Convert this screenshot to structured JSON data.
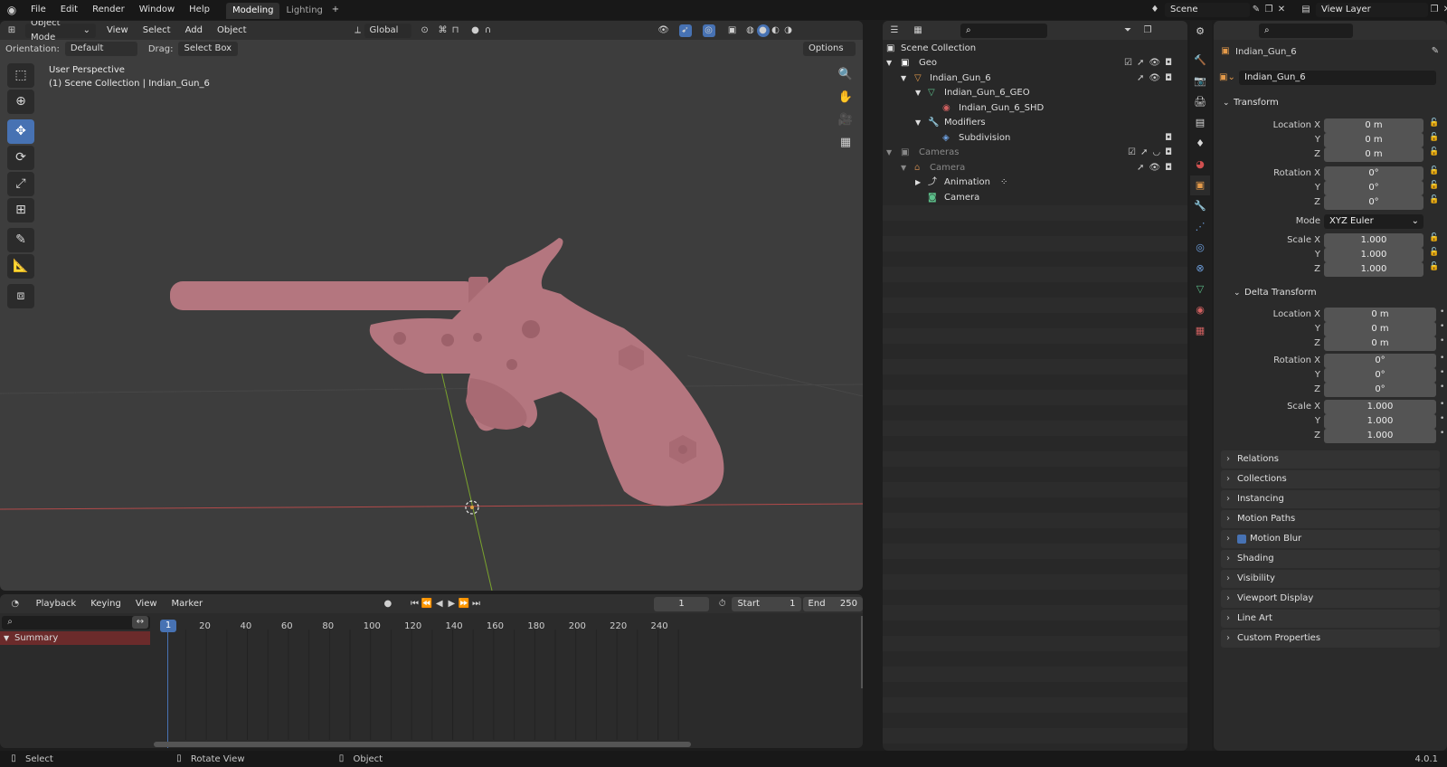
{
  "topbar": {
    "menus": [
      "File",
      "Edit",
      "Render",
      "Window",
      "Help"
    ],
    "workspaces": [
      "Modeling",
      "Lighting"
    ],
    "active_workspace": "Modeling",
    "scene": "Scene",
    "view_layer": "View Layer"
  },
  "viewport_header": {
    "mode": "Object Mode",
    "menus": [
      "View",
      "Select",
      "Add",
      "Object"
    ],
    "transform_orientation": "Global",
    "orientation_label": "Orientation:",
    "orientation_value": "Default",
    "drag_label": "Drag:",
    "drag_value": "Select Box",
    "options_label": "Options"
  },
  "viewport": {
    "perspective": "User Perspective",
    "context": "(1) Scene Collection | Indian_Gun_6",
    "tools": [
      "select-box",
      "cursor",
      "move",
      "rotate",
      "scale",
      "transform",
      "annotate",
      "measure",
      "add-cube"
    ]
  },
  "timeline": {
    "menus": [
      "Playback",
      "Keying",
      "View",
      "Marker"
    ],
    "current_frame": "1",
    "start_label": "Start",
    "start_value": "1",
    "end_label": "End",
    "end_value": "250",
    "ticks": [
      "1",
      "20",
      "40",
      "60",
      "80",
      "100",
      "120",
      "140",
      "160",
      "180",
      "200",
      "220",
      "240"
    ],
    "summary_label": "Summary"
  },
  "outliner": {
    "root": "Scene Collection",
    "rows": [
      {
        "label": "Geo",
        "icon": "collection-icon"
      },
      {
        "label": "Indian_Gun_6",
        "icon": "object-icon"
      },
      {
        "label": "Indian_Gun_6_GEO",
        "icon": "mesh-icon"
      },
      {
        "label": "Indian_Gun_6_SHD",
        "icon": "material-icon"
      },
      {
        "label": "Modifiers",
        "icon": "wrench-icon"
      },
      {
        "label": "Subdivision",
        "icon": "modifier-icon"
      },
      {
        "label": "Cameras",
        "icon": "collection-icon"
      },
      {
        "label": "Camera",
        "icon": "camera-object-icon"
      },
      {
        "label": "Animation",
        "icon": "animation-icon"
      },
      {
        "label": "Camera",
        "icon": "camera-data-icon"
      }
    ]
  },
  "properties": {
    "object_name": "Indian_Gun_6",
    "name_field": "Indian_Gun_6",
    "transform_title": "Transform",
    "location": {
      "label": "Location X",
      "x": "0 m",
      "y": "0 m",
      "z": "0 m"
    },
    "rotation": {
      "label": "Rotation X",
      "x": "0°",
      "y": "0°",
      "z": "0°"
    },
    "mode_label": "Mode",
    "mode_value": "XYZ Euler",
    "scale": {
      "label": "Scale X",
      "x": "1.000",
      "y": "1.000",
      "z": "1.000"
    },
    "axis_y": "Y",
    "axis_z": "Z",
    "delta_title": "Delta Transform",
    "delta_location": {
      "label": "Location X",
      "x": "0 m",
      "y": "0 m",
      "z": "0 m"
    },
    "delta_rotation": {
      "label": "Rotation X",
      "x": "0°",
      "y": "0°",
      "z": "0°"
    },
    "delta_scale": {
      "label": "Scale X",
      "x": "1.000",
      "y": "1.000",
      "z": "1.000"
    },
    "sections": [
      "Relations",
      "Collections",
      "Instancing",
      "Motion Paths",
      "Motion Blur",
      "Shading",
      "Visibility",
      "Viewport Display",
      "Line Art",
      "Custom Properties"
    ]
  },
  "statusbar": {
    "select": "Select",
    "rotate_view": "Rotate View",
    "object": "Object",
    "version": "4.0.1"
  },
  "colors": {
    "accent": "#4772b3",
    "gun": "#b4767f",
    "x_axis": "#b34a4a",
    "y_axis": "#7aa32e"
  }
}
